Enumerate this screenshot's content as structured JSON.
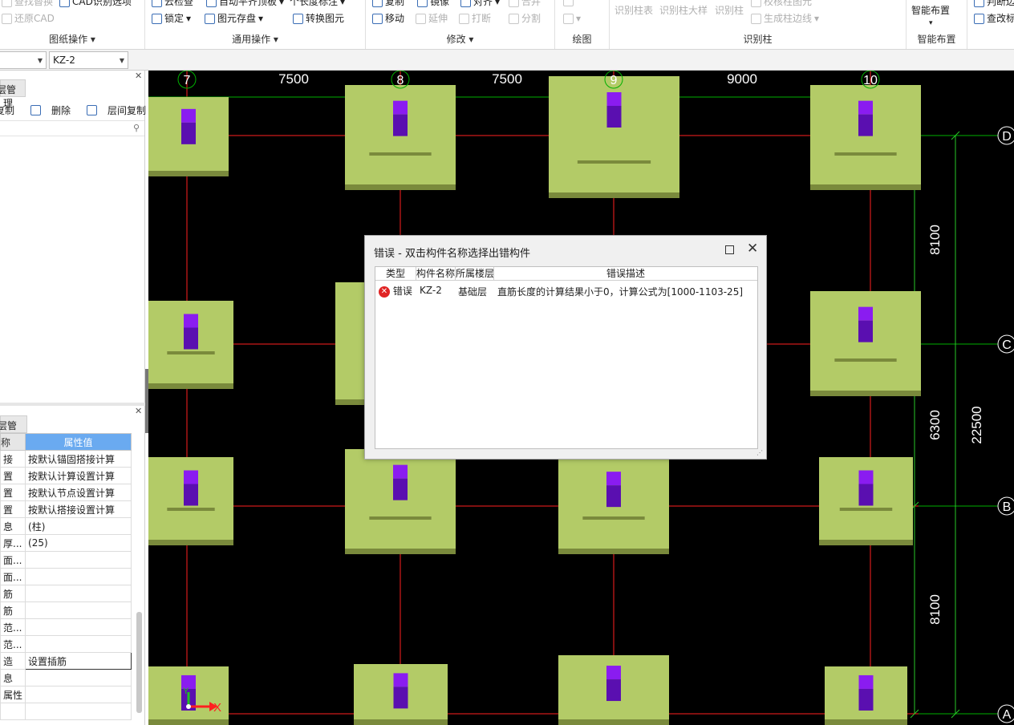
{
  "ribbon": {
    "g1": {
      "r1a": "查找替换",
      "r1b": "CAD识别选项",
      "r2": "还原CAD",
      "label": "图纸操作"
    },
    "g2": {
      "r1a": "云检查",
      "r1b": "自动平齐顶板",
      "r1c": "个长度标注",
      "r2a": "锁定",
      "r2b": "图元存盘",
      "r2c": "转换图元",
      "label": "通用操作"
    },
    "g3": {
      "r1a": "复制",
      "r1b": "镜像",
      "r1c": "对齐",
      "r1d": "合并",
      "r2a": "移动",
      "r2b": "延伸",
      "r2c": "打断",
      "r2d": "分割",
      "label": "修改"
    },
    "g4": {
      "label": "绘图"
    },
    "g5": {
      "r1a": "识别柱表",
      "r1b": "识别柱大样",
      "r1c": "识别柱",
      "r1d": "校核柱图元",
      "r2": "生成柱边线",
      "label": "识别柱"
    },
    "g6": {
      "r1": "智能布置",
      "label": "智能布置"
    },
    "g7": {
      "r1": "判断边",
      "r2": "查改标"
    }
  },
  "toolbar2": {
    "combo2": "KZ-2"
  },
  "left": {
    "tab1": "层管理",
    "tools": {
      "copy": "复制",
      "delete": "删除",
      "floor_copy": "层间复制"
    },
    "tab2": "层管理",
    "prop_header_name": "称",
    "prop_header_value": "属性值",
    "rows": [
      {
        "n": "接",
        "v": "按默认锚固搭接计算"
      },
      {
        "n": "置",
        "v": "按默认计算设置计算"
      },
      {
        "n": "置",
        "v": "按默认节点设置计算"
      },
      {
        "n": "置",
        "v": "按默认搭接设置计算"
      },
      {
        "n": "息",
        "v": "(柱)"
      },
      {
        "n": "厚...",
        "v": "(25)"
      },
      {
        "n": "面...",
        "v": ""
      },
      {
        "n": "面...",
        "v": ""
      },
      {
        "n": "筋",
        "v": ""
      },
      {
        "n": "筋",
        "v": ""
      },
      {
        "n": "范...",
        "v": ""
      },
      {
        "n": "范...",
        "v": ""
      },
      {
        "n": "造",
        "v": "设置插筋"
      },
      {
        "n": "息",
        "v": ""
      },
      {
        "n": "属性",
        "v": ""
      },
      {
        "n": "",
        "v": ""
      }
    ]
  },
  "canvas": {
    "axis_x": [
      "7",
      "8",
      "9",
      "10"
    ],
    "axis_y": [
      "D",
      "C",
      "B",
      "A"
    ],
    "dims_top": [
      "7500",
      "7500",
      "9000"
    ],
    "dims_right_inner": [
      "8100",
      "6300",
      "8100"
    ],
    "dims_right_outer": "22500",
    "ucs_x": "X",
    "ucs_y": "Y",
    "colors": {
      "column_fill": "#b3cb67",
      "column_shadow": "#7a8a3c",
      "rebar_top": "#8a1cf0",
      "rebar_bottom": "#5a0fb0",
      "grid_red": "#ff2020",
      "grid_green": "#00b000",
      "dim_green": "#28c828"
    }
  },
  "dialog": {
    "title": "错误 - 双击构件名称选择出错构件",
    "columns": [
      "类型",
      "构件名称",
      "所属楼层",
      "错误描述"
    ],
    "rows": [
      {
        "type": "错误",
        "name": "KZ-2",
        "floor": "基础层",
        "desc": "直筋长度的计算结果小于0，计算公式为[1000-1103-25]"
      }
    ]
  }
}
